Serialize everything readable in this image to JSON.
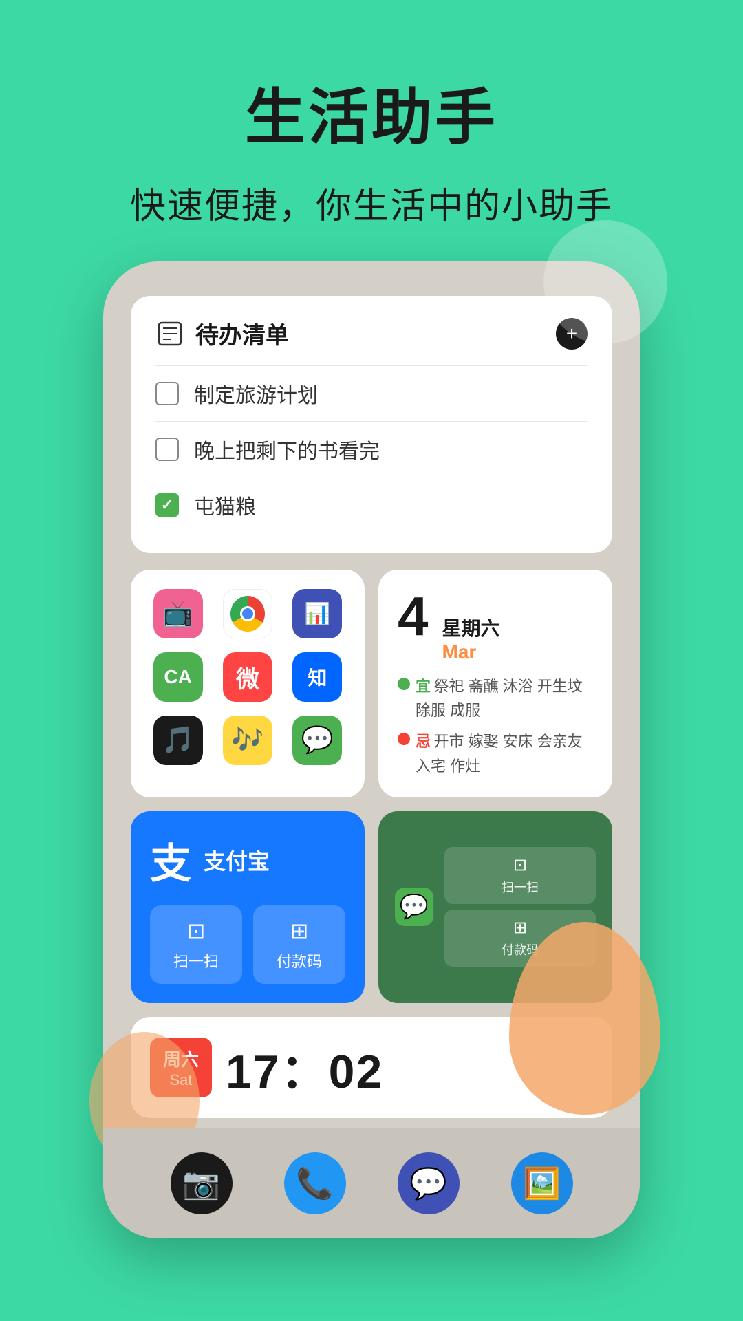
{
  "header": {
    "main_title": "生活助手",
    "sub_title": "快速便捷，你生活中的小助手"
  },
  "todo_widget": {
    "title": "待办清单",
    "items": [
      {
        "text": "制定旅游计划",
        "checked": false
      },
      {
        "text": "晚上把剩下的书看完",
        "checked": false
      },
      {
        "text": "屯猫粮",
        "checked": true
      }
    ]
  },
  "calendar_widget": {
    "date": "4",
    "weekday": "星期六",
    "month": "Mar",
    "auspicious_label": "宜",
    "auspicious_items": "祭祀  斋醮  沐浴\n开生坟  除服  成服",
    "inauspicious_label": "忌",
    "inauspicious_items": "开市  嫁娶  安床\n会亲友  入宅  作灶"
  },
  "alipay_widget": {
    "logo": "支",
    "name": "支付宝",
    "scan_label": "扫一扫",
    "payment_label": "付款码"
  },
  "wechat_widget": {
    "scan_label": "扫一扫",
    "payment_label": "付款码"
  },
  "clock_widget": {
    "weekday": "周六",
    "sat": "Sat",
    "time": "17：02"
  },
  "dock": {
    "icons": [
      "📷",
      "📞",
      "💬",
      "🖼️"
    ]
  },
  "apps": [
    {
      "emoji": "📺",
      "bg": "pink"
    },
    {
      "emoji": "chrome",
      "bg": "chrome"
    },
    {
      "emoji": "📊",
      "bg": "blue-dark"
    },
    {
      "emoji": "CA",
      "bg": "green"
    },
    {
      "emoji": "微",
      "bg": "weibo"
    },
    {
      "emoji": "知",
      "bg": "yellow-green"
    },
    {
      "emoji": "♪",
      "bg": "black"
    },
    {
      "emoji": "🎵",
      "bg": "yellow"
    },
    {
      "emoji": "💬",
      "bg": "wechat-dark"
    }
  ]
}
